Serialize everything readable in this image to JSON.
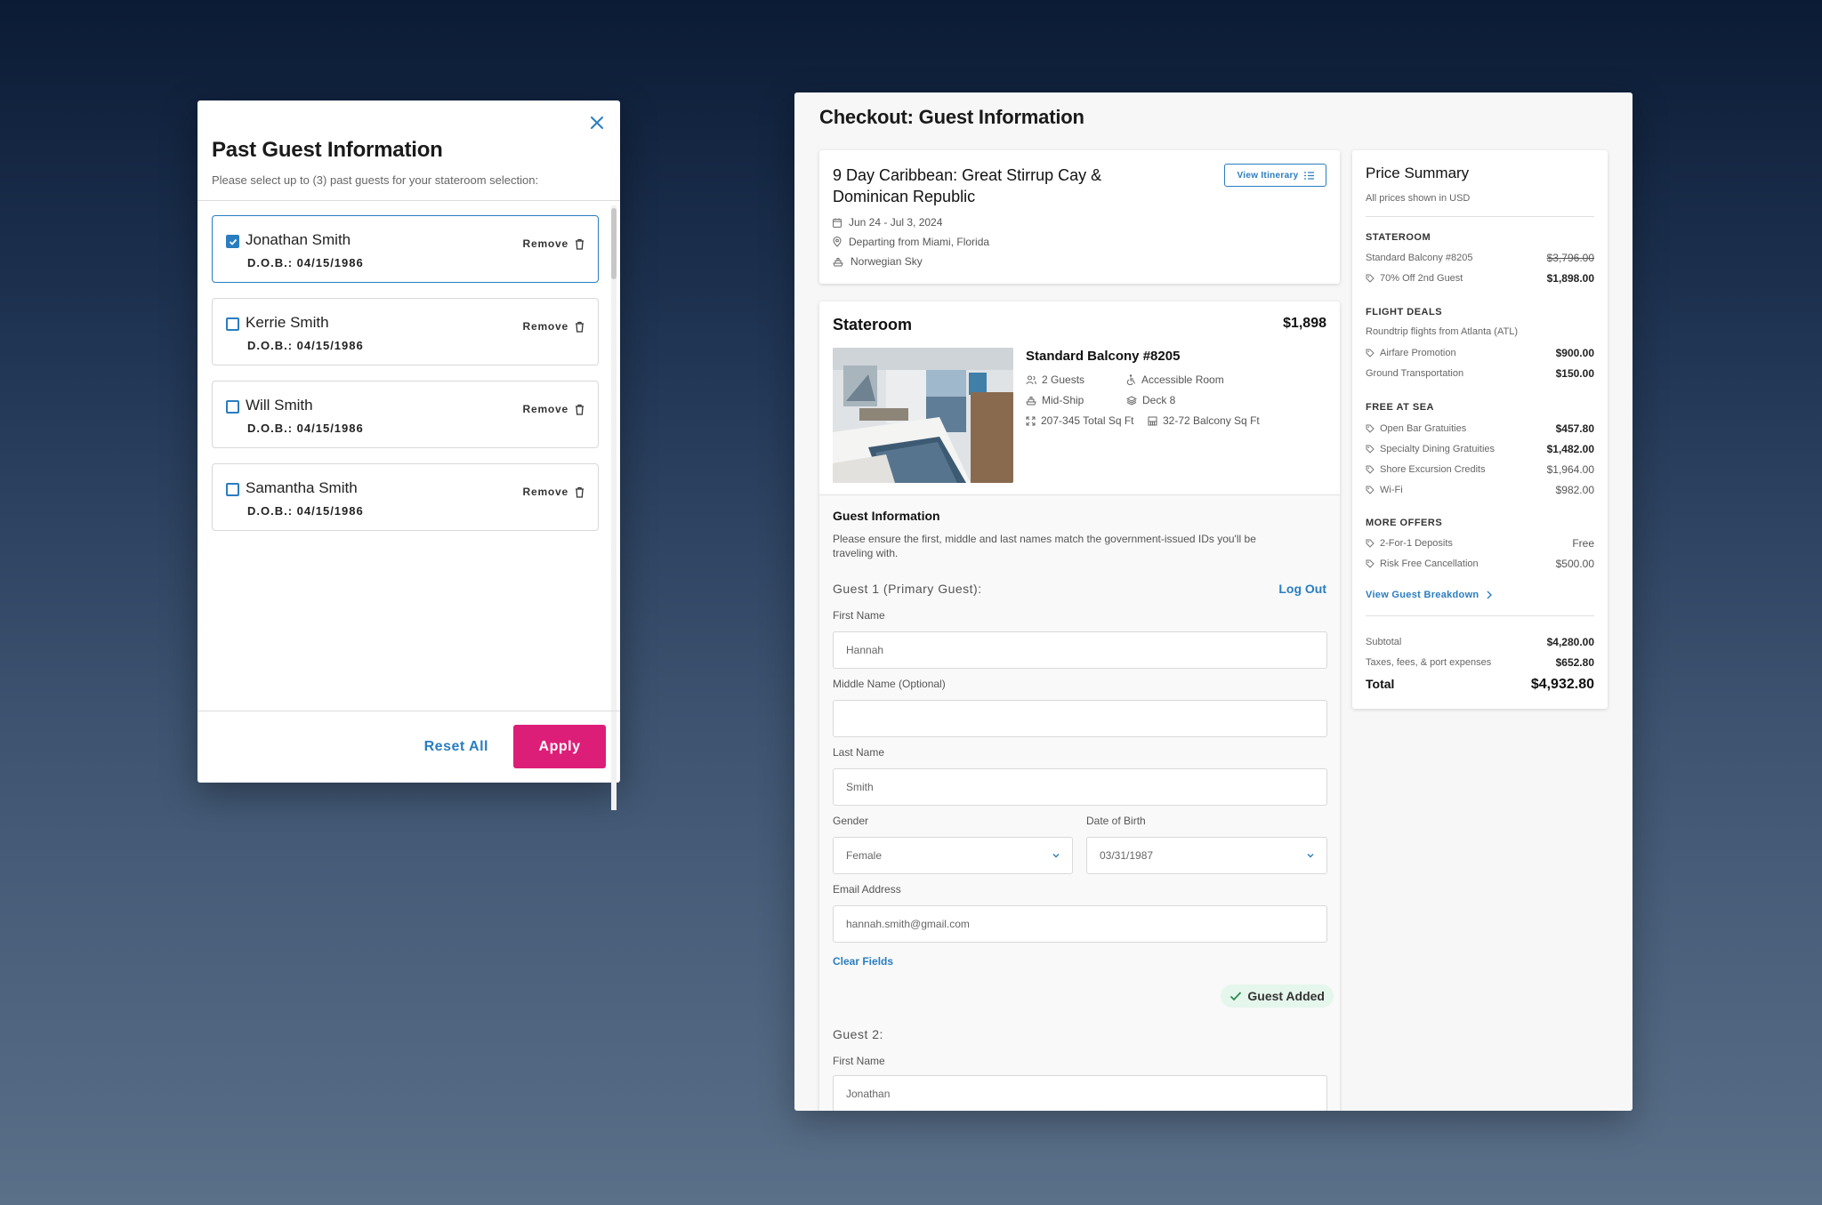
{
  "modal": {
    "title": "Past Guest Information",
    "subtitle": "Please select up to (3) past guests for your stateroom selection:",
    "guests": [
      {
        "name": "Jonathan Smith",
        "dob": "D.O.B.: 04/15/1986",
        "remove": "Remove",
        "checked": true
      },
      {
        "name": "Kerrie Smith",
        "dob": "D.O.B.: 04/15/1986",
        "remove": "Remove",
        "checked": false
      },
      {
        "name": "Will Smith",
        "dob": "D.O.B.: 04/15/1986",
        "remove": "Remove",
        "checked": false
      },
      {
        "name": "Samantha Smith",
        "dob": "D.O.B.: 04/15/1986",
        "remove": "Remove",
        "checked": false
      }
    ],
    "reset_label": "Reset All",
    "apply_label": "Apply"
  },
  "checkout": {
    "title": "Checkout: Guest Information",
    "trip": {
      "title": "9 Day Caribbean: Great Stirrup Cay & Dominican Republic",
      "itinerary_button": "View Itinerary",
      "dates": "Jun 24 - Jul 3, 2024",
      "departure": "Departing from Miami, Florida",
      "ship": "Norwegian Sky"
    },
    "stateroom": {
      "title": "Stateroom",
      "price": "$1,898",
      "room_name": "Standard Balcony #8205",
      "features": {
        "guests": "2 Guests",
        "accessible": "Accessible Room",
        "location": "Mid-Ship",
        "deck": "Deck 8",
        "total_sqft": "207-345 Total Sq Ft",
        "balcony_sqft": "32-72 Balcony Sq Ft"
      }
    },
    "guest_info": {
      "heading": "Guest Information",
      "note": "Please ensure the first, middle and last names match the government-issued IDs you'll be traveling with.",
      "guest1_label": "Guest 1 (Primary Guest):",
      "logout": "Log Out",
      "first_name_label": "First Name",
      "first_name": "Hannah",
      "middle_name_label": "Middle Name (Optional)",
      "middle_name": "",
      "last_name_label": "Last Name",
      "last_name": "Smith",
      "gender_label": "Gender",
      "gender": "Female",
      "dob_label": "Date of Birth",
      "dob": "03/31/1987",
      "email_label": "Email Address",
      "email": "hannah.smith@gmail.com",
      "clear_fields": "Clear Fields",
      "guest_added": "Guest Added",
      "guest2_label": "Guest 2:",
      "guest2_first_name_label": "First Name",
      "guest2_first_name": "Jonathan"
    },
    "price_summary": {
      "title": "Price Summary",
      "subtitle": "All prices shown in USD",
      "stateroom_heading": "STATEROOM",
      "stateroom_rows": [
        {
          "label": "Standard Balcony #8205",
          "value": "$3,796.00"
        },
        {
          "label": "70% Off 2nd Guest",
          "value": "$1,898.00"
        }
      ],
      "flight_heading": "FLIGHT DEALS",
      "flight_note": "Roundtrip flights from Atlanta (ATL)",
      "flight_rows": [
        {
          "label": "Airfare Promotion",
          "value": "$900.00"
        },
        {
          "label": "Ground Transportation",
          "value": "$150.00"
        }
      ],
      "sea_heading": "FREE AT SEA",
      "sea_rows": [
        {
          "label": "Open Bar Gratuities",
          "value": "$457.80"
        },
        {
          "label": "Specialty Dining Gratuities",
          "value": "$1,482.00"
        },
        {
          "label": "Shore Excursion Credits",
          "value": "$1,964.00"
        },
        {
          "label": "Wi-Fi",
          "value": "$982.00"
        }
      ],
      "offers_heading": "MORE OFFERS",
      "offers_rows": [
        {
          "label": "2-For-1 Deposits",
          "value": "Free"
        },
        {
          "label": "Risk Free Cancellation",
          "value": "$500.00"
        }
      ],
      "breakdown_link": "View Guest Breakdown",
      "subtotal_label": "Subtotal",
      "subtotal": "$4,280.00",
      "taxes_label": "Taxes, fees, & port expenses",
      "taxes": "$652.80",
      "total_label": "Total",
      "total": "$4,932.80"
    }
  },
  "colors": {
    "accent": "#2a7dc0",
    "cta": "#dd1e78",
    "success_bg": "#e5f6ec"
  }
}
